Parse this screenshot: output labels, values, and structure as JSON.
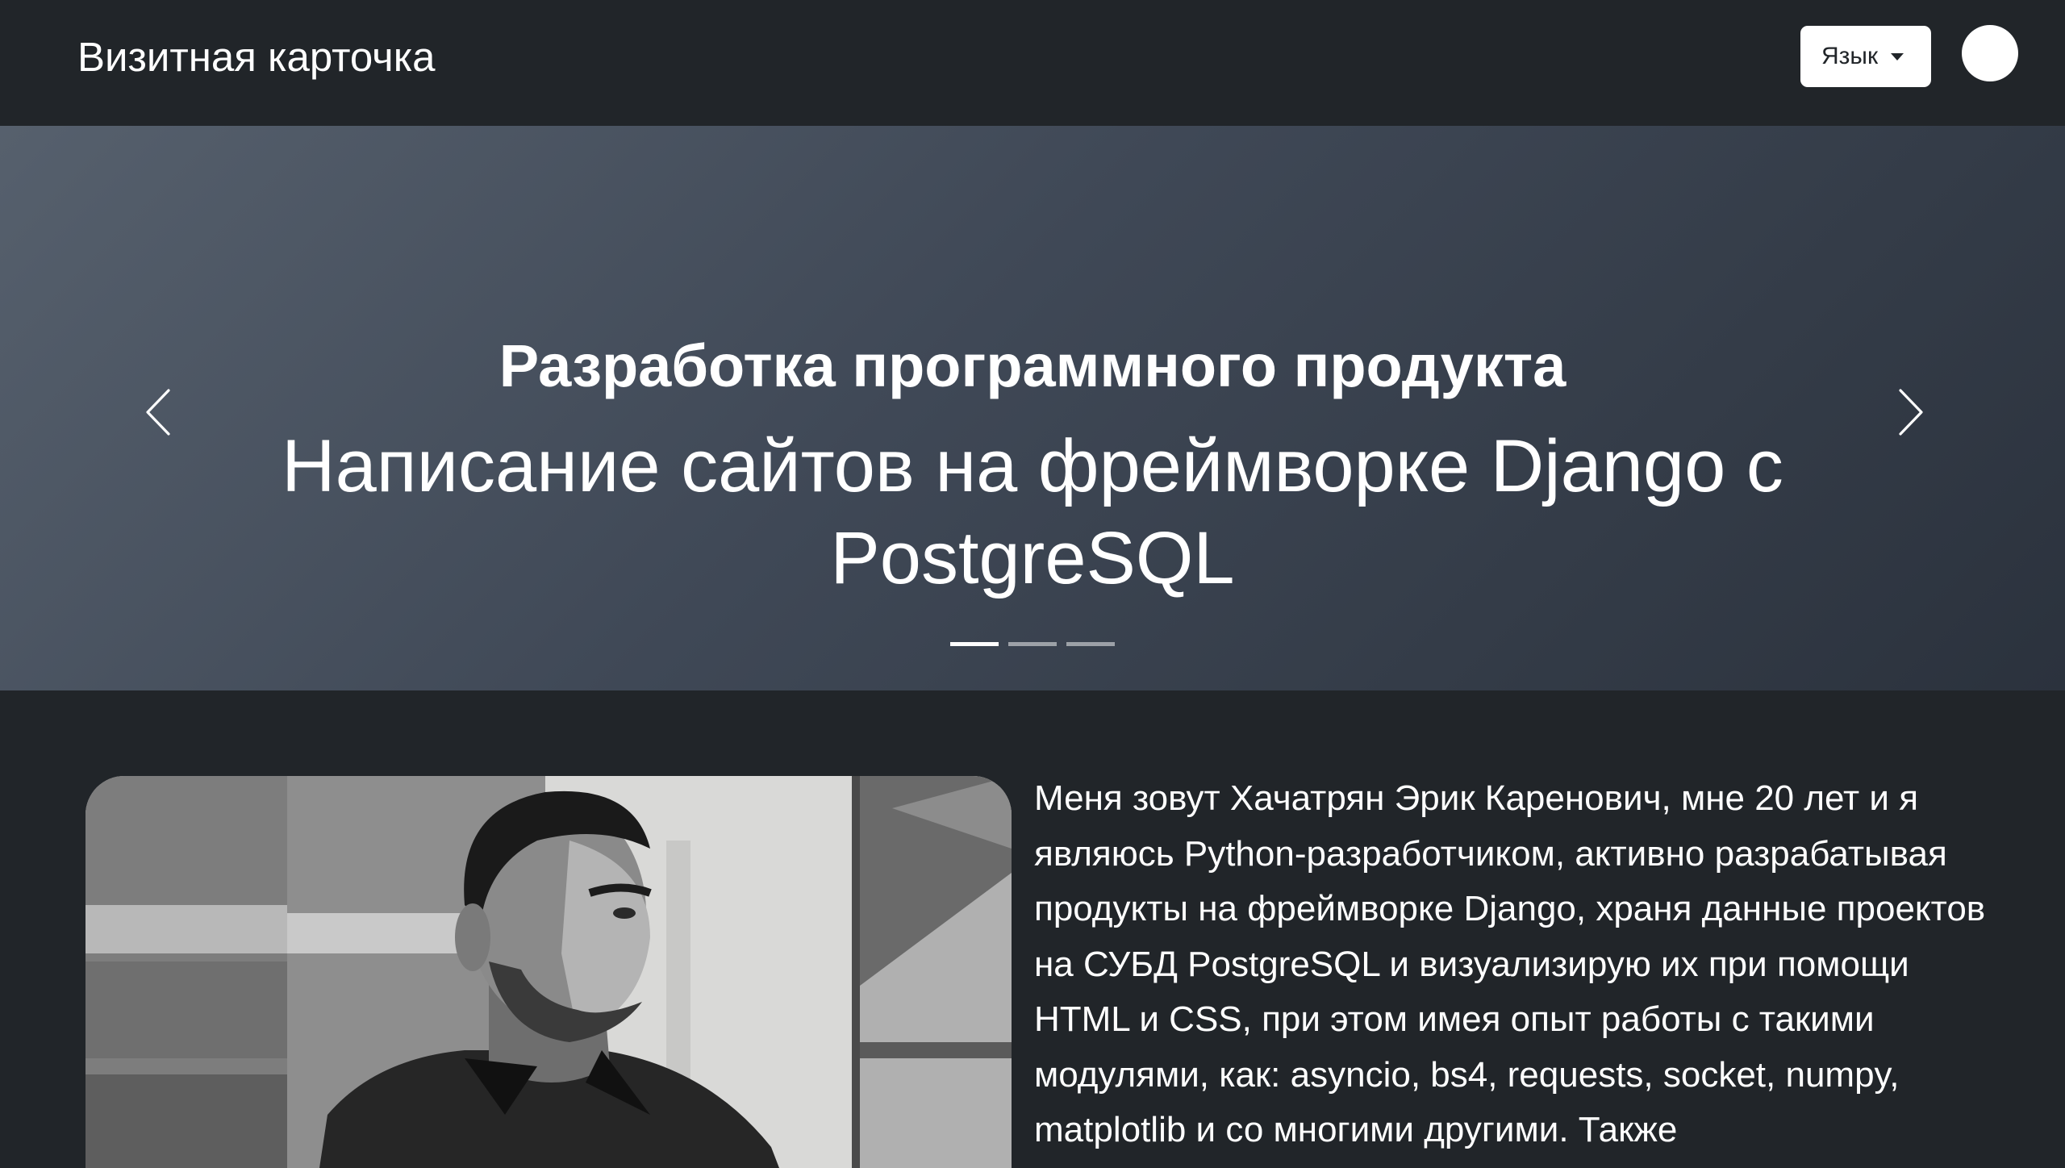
{
  "navbar": {
    "brand": "Визитная карточка",
    "language_button": "Язык",
    "avatar_label": ""
  },
  "carousel": {
    "title": "Разработка программного продукта",
    "text": "Написание сайтов на фреймворке Django с PostgreSQL",
    "indicator_count": 3,
    "active_index": 0
  },
  "about": {
    "photo_icon": "portrait-photo",
    "text": "Меня зовут Хачатрян Эрик Каренович, мне 20 лет и я являюсь Python-разработчиком, активно разрабатывая продукты на фреймворке Django, храня данные проектов на СУБД PostgreSQL и визуализирую их при помощи HTML и CSS, при этом имея опыт работы с такими модулями, как: asyncio, bs4, requests, socket, numpy, matplotlib и со многими другими. Также"
  },
  "colors": {
    "background": "#212529",
    "text": "#ffffff"
  }
}
